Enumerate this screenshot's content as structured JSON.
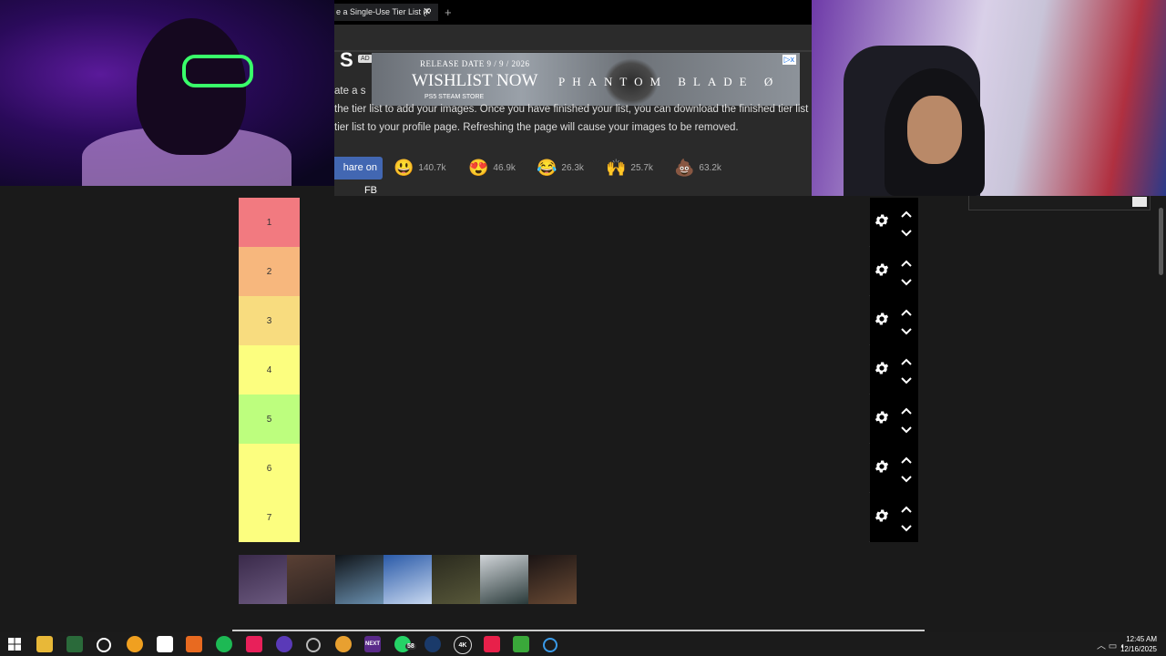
{
  "browser": {
    "tab_title": "e a Single-Use Tier List (P",
    "tab_close": "✕",
    "new_tab": "+"
  },
  "site": {
    "logo": "S",
    "description_lines": [
      "ate a s",
      "the tier list to add your images. Once you have finished your list, you can download the finished tier list im",
      "tier list to your profile page. Refreshing the page will cause your images to be removed."
    ],
    "share_button": "hare on FB",
    "reactions": [
      {
        "emoji": "😃",
        "count": "140.7k"
      },
      {
        "emoji": "😍",
        "count": "46.9k"
      },
      {
        "emoji": "😂",
        "count": "26.3k"
      },
      {
        "emoji": "🙌",
        "count": "25.7k"
      },
      {
        "emoji": "💩",
        "count": "63.2k"
      }
    ]
  },
  "ad": {
    "badge": "AD",
    "release": "RELEASE DATE 9 / 9 / 2026",
    "cta": "WISHLIST NOW",
    "title": "PHANTOM BLADE Ø",
    "platforms": "PS5   STEAM   STORE",
    "close": "▷x"
  },
  "tiers": [
    {
      "label": "1",
      "color": "#f27a80"
    },
    {
      "label": "2",
      "color": "#f7b77d"
    },
    {
      "label": "3",
      "color": "#f8dc7f"
    },
    {
      "label": "4",
      "color": "#fcfe7f"
    },
    {
      "label": "5",
      "color": "#bdfe7e"
    },
    {
      "label": "6",
      "color": "#fcfe7f"
    },
    {
      "label": "7",
      "color": "#fcfe7f"
    }
  ],
  "pool_images": [
    {
      "colors": [
        "#3a2a4a",
        "#6c5a80"
      ]
    },
    {
      "colors": [
        "#5a4034",
        "#2a2220"
      ]
    },
    {
      "colors": [
        "#101418",
        "#6a90b0"
      ]
    },
    {
      "colors": [
        "#2a5aa8",
        "#c8d8f0"
      ]
    },
    {
      "colors": [
        "#2a2a1e",
        "#58583a"
      ]
    },
    {
      "colors": [
        "#d0d4d8",
        "#2a3a3a"
      ]
    },
    {
      "colors": [
        "#1a1414",
        "#6a4a34"
      ]
    }
  ],
  "taskbar": {
    "whatsapp_badge": "58",
    "steam_label": "4K",
    "time": "12:45 AM",
    "date": "12/16/2025"
  }
}
